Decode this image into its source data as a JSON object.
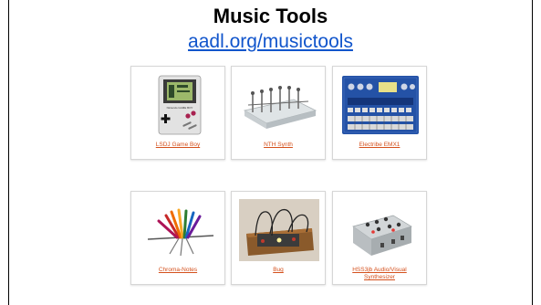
{
  "slide": {
    "title": "Music Tools",
    "link_text": "aadl.org/musictools"
  },
  "tools": [
    {
      "caption": "LSDJ Game Boy",
      "icon": "gameboy-image"
    },
    {
      "caption": "NTH Synth",
      "icon": "synth-image"
    },
    {
      "caption": "Electribe EMX1",
      "icon": "electribe-image"
    },
    {
      "caption": "Chroma-Notes",
      "icon": "chroma-notes-image"
    },
    {
      "caption": "Bug",
      "icon": "bug-synth-image"
    },
    {
      "caption": "HSS3jb Audio/Visual Synthesizer",
      "icon": "hss3jb-image"
    }
  ],
  "colors": {
    "link": "#1155cc",
    "caption": "#d4501c",
    "card_border": "#d6d6d6"
  }
}
